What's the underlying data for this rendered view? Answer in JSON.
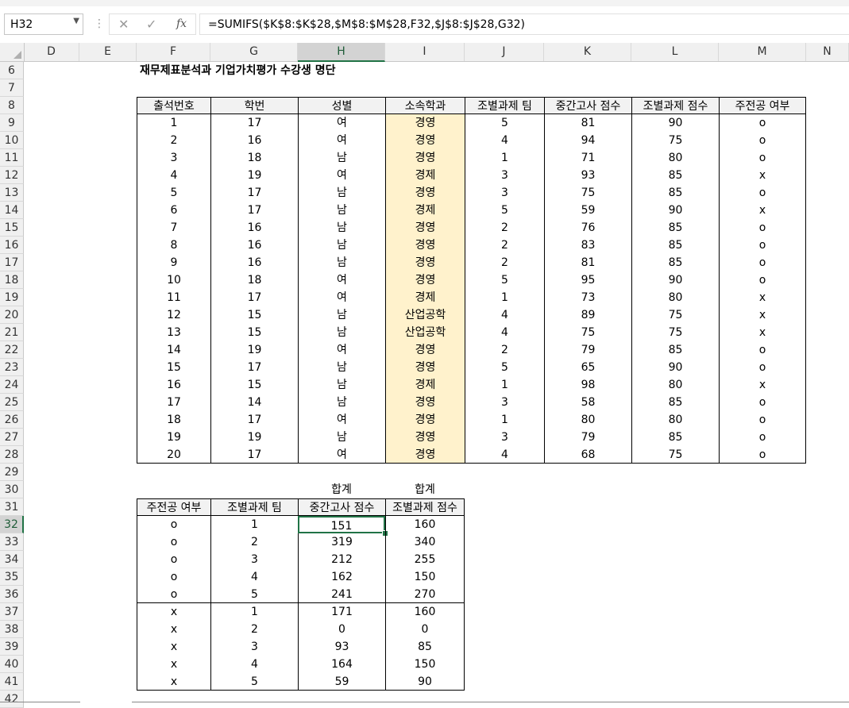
{
  "name_box": "H32",
  "formula": "=SUMIFS($K$8:$K$28,$M$8:$M$28,F32,$J$8:$J$28,G32)",
  "columns": [
    "D",
    "E",
    "F",
    "G",
    "H",
    "I",
    "J",
    "K",
    "L",
    "M",
    "N"
  ],
  "rows": [
    6,
    7,
    8,
    9,
    10,
    11,
    12,
    13,
    14,
    15,
    16,
    17,
    18,
    19,
    20,
    21,
    22,
    23,
    24,
    25,
    26,
    27,
    28,
    29,
    30,
    31,
    32,
    33,
    34,
    35,
    36,
    37,
    38,
    39,
    40,
    41,
    42
  ],
  "title": "재무제표분석과 기업가치평가 수강생 명단",
  "main_table": {
    "headers": [
      "출석번호",
      "학번",
      "성별",
      "소속학과",
      "조별과제 팀",
      "중간고사 점수",
      "조별과제 점수",
      "주전공 여부"
    ],
    "rows": [
      [
        "1",
        "17",
        "여",
        "경영",
        "5",
        "81",
        "90",
        "o"
      ],
      [
        "2",
        "16",
        "여",
        "경영",
        "4",
        "94",
        "75",
        "o"
      ],
      [
        "3",
        "18",
        "남",
        "경영",
        "1",
        "71",
        "80",
        "o"
      ],
      [
        "4",
        "19",
        "여",
        "경제",
        "3",
        "93",
        "85",
        "x"
      ],
      [
        "5",
        "17",
        "남",
        "경영",
        "3",
        "75",
        "85",
        "o"
      ],
      [
        "6",
        "17",
        "남",
        "경제",
        "5",
        "59",
        "90",
        "x"
      ],
      [
        "7",
        "16",
        "남",
        "경영",
        "2",
        "76",
        "85",
        "o"
      ],
      [
        "8",
        "16",
        "남",
        "경영",
        "2",
        "83",
        "85",
        "o"
      ],
      [
        "9",
        "16",
        "남",
        "경영",
        "2",
        "81",
        "85",
        "o"
      ],
      [
        "10",
        "18",
        "여",
        "경영",
        "5",
        "95",
        "90",
        "o"
      ],
      [
        "11",
        "17",
        "여",
        "경제",
        "1",
        "73",
        "80",
        "x"
      ],
      [
        "12",
        "15",
        "남",
        "산업공학",
        "4",
        "89",
        "75",
        "x"
      ],
      [
        "13",
        "15",
        "남",
        "산업공학",
        "4",
        "75",
        "75",
        "x"
      ],
      [
        "14",
        "19",
        "여",
        "경영",
        "2",
        "79",
        "85",
        "o"
      ],
      [
        "15",
        "17",
        "남",
        "경영",
        "5",
        "65",
        "90",
        "o"
      ],
      [
        "16",
        "15",
        "남",
        "경제",
        "1",
        "98",
        "80",
        "x"
      ],
      [
        "17",
        "14",
        "남",
        "경영",
        "3",
        "58",
        "85",
        "o"
      ],
      [
        "18",
        "17",
        "여",
        "경영",
        "1",
        "80",
        "80",
        "o"
      ],
      [
        "19",
        "19",
        "남",
        "경영",
        "3",
        "79",
        "85",
        "o"
      ],
      [
        "20",
        "17",
        "여",
        "경영",
        "4",
        "68",
        "75",
        "o"
      ]
    ]
  },
  "summary_table": {
    "sum_labels": [
      "합계",
      "합계"
    ],
    "headers": [
      "주전공 여부",
      "조별과제 팀",
      "중간고사 점수",
      "조별과제 점수"
    ],
    "rows": [
      [
        "o",
        "1",
        "151",
        "160"
      ],
      [
        "o",
        "2",
        "319",
        "340"
      ],
      [
        "o",
        "3",
        "212",
        "255"
      ],
      [
        "o",
        "4",
        "162",
        "150"
      ],
      [
        "o",
        "5",
        "241",
        "270"
      ],
      [
        "x",
        "1",
        "171",
        "160"
      ],
      [
        "x",
        "2",
        "0",
        "0"
      ],
      [
        "x",
        "3",
        "93",
        "85"
      ],
      [
        "x",
        "4",
        "164",
        "150"
      ],
      [
        "x",
        "5",
        "59",
        "90"
      ]
    ]
  },
  "colors": {
    "highlight": "#fff2cc",
    "accent": "#217346"
  }
}
